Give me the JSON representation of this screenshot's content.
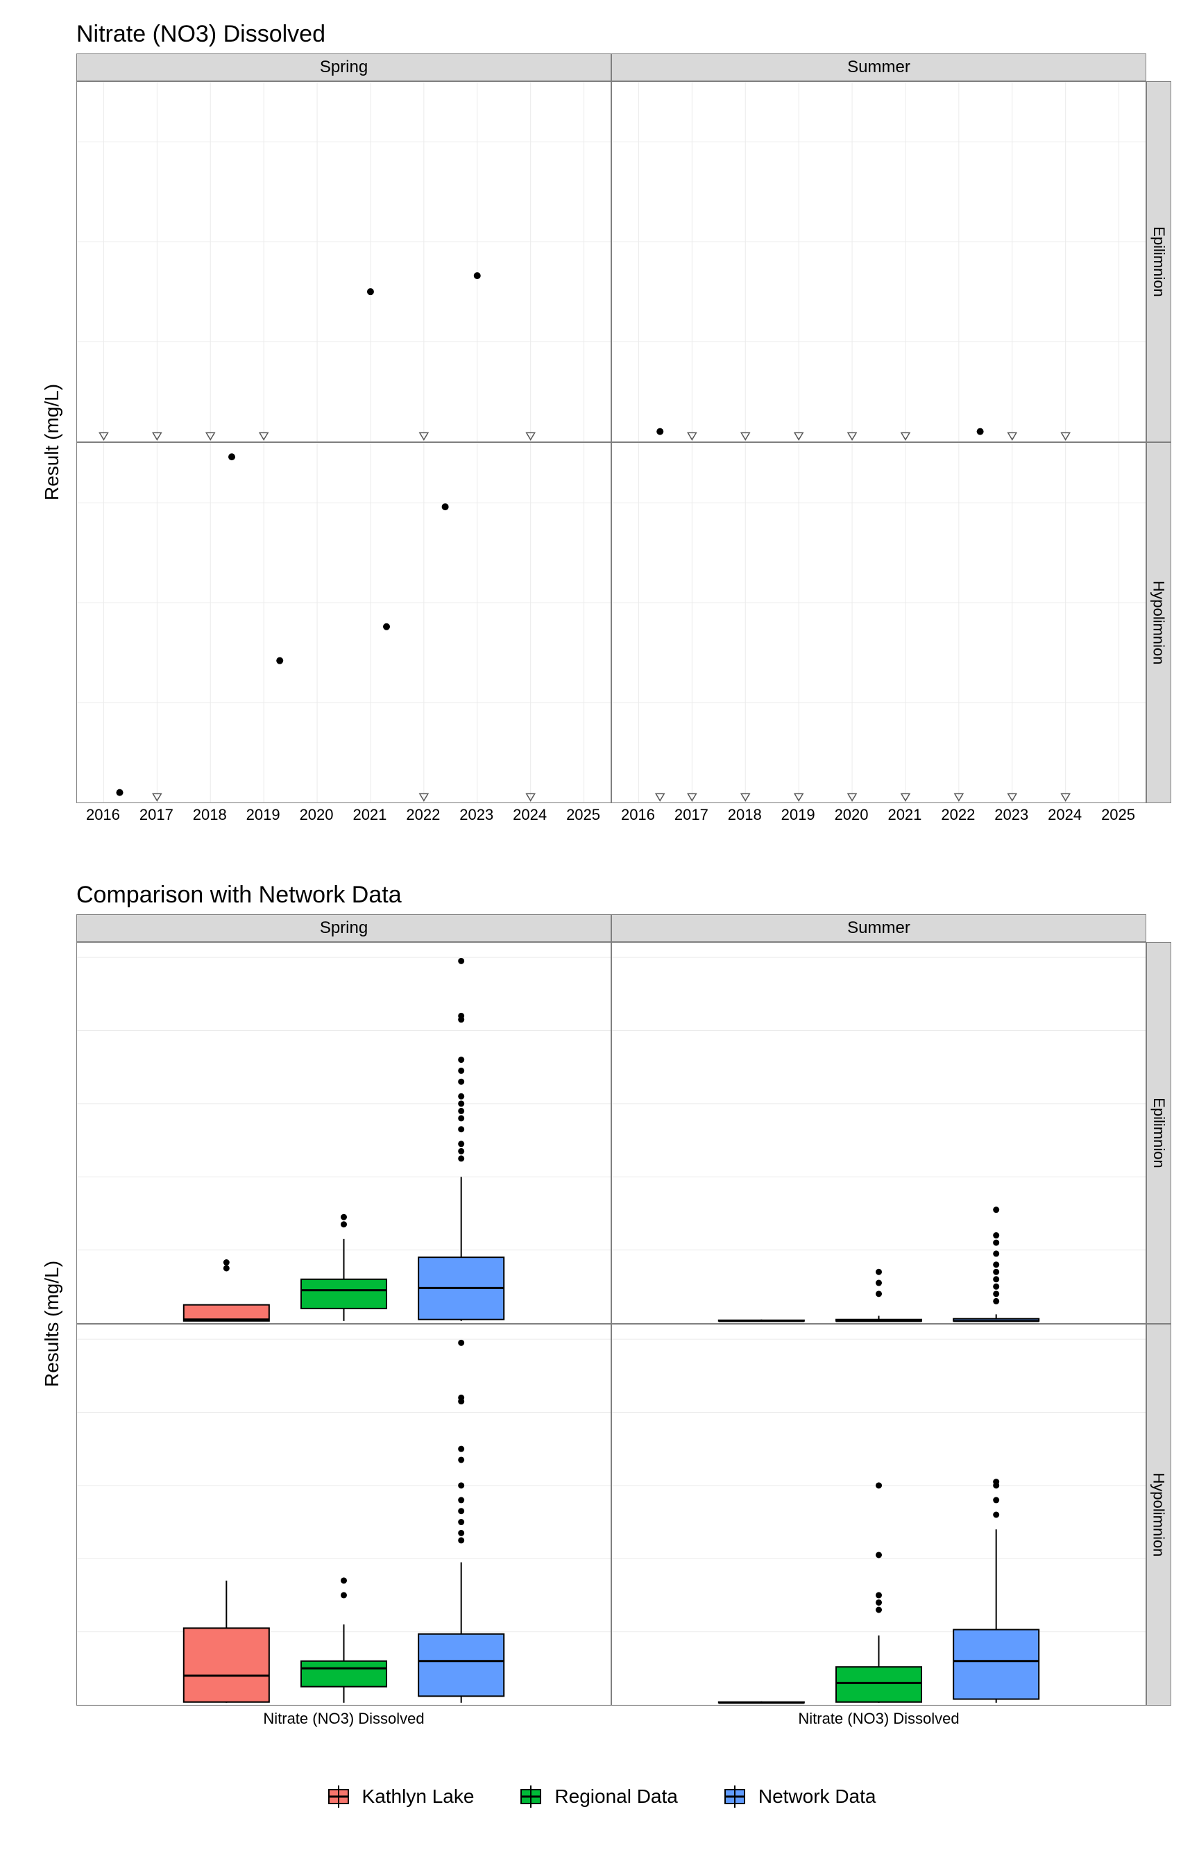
{
  "chart_data": [
    {
      "type": "scatter",
      "title": "Nitrate (NO3) Dissolved",
      "ylabel": "Result (mg/L)",
      "facets_col": [
        "Spring",
        "Summer"
      ],
      "facets_row": [
        "Epilimnion",
        "Hypolimnion"
      ],
      "x_ticks": [
        2016,
        2017,
        2018,
        2019,
        2020,
        2021,
        2022,
        2023,
        2024,
        2025
      ],
      "ylim": [
        0,
        0.18
      ],
      "y_ticks": [
        0.0,
        0.05,
        0.1,
        0.15
      ],
      "panels": {
        "Spring_Epilimnion": {
          "detect": [
            {
              "x": 2021,
              "y": 0.075
            },
            {
              "x": 2023,
              "y": 0.083
            }
          ],
          "nondetect": [
            {
              "x": 2016,
              "y": 0.003
            },
            {
              "x": 2017,
              "y": 0.003
            },
            {
              "x": 2018,
              "y": 0.003
            },
            {
              "x": 2019,
              "y": 0.003
            },
            {
              "x": 2022,
              "y": 0.003
            },
            {
              "x": 2024,
              "y": 0.003
            }
          ]
        },
        "Summer_Epilimnion": {
          "detect": [
            {
              "x": 2016.4,
              "y": 0.005
            },
            {
              "x": 2022.4,
              "y": 0.005
            }
          ],
          "nondetect": [
            {
              "x": 2017,
              "y": 0.003
            },
            {
              "x": 2018,
              "y": 0.003
            },
            {
              "x": 2019,
              "y": 0.003
            },
            {
              "x": 2020,
              "y": 0.003
            },
            {
              "x": 2021,
              "y": 0.003
            },
            {
              "x": 2023,
              "y": 0.003
            },
            {
              "x": 2024,
              "y": 0.003
            }
          ]
        },
        "Spring_Hypolimnion": {
          "detect": [
            {
              "x": 2016.3,
              "y": 0.005
            },
            {
              "x": 2018.4,
              "y": 0.173
            },
            {
              "x": 2019.3,
              "y": 0.071
            },
            {
              "x": 2021.3,
              "y": 0.088
            },
            {
              "x": 2022.4,
              "y": 0.148
            }
          ],
          "nondetect": [
            {
              "x": 2017,
              "y": 0.003
            },
            {
              "x": 2022,
              "y": 0.003
            },
            {
              "x": 2024,
              "y": 0.003
            }
          ]
        },
        "Summer_Hypolimnion": {
          "detect": [],
          "nondetect": [
            {
              "x": 2016.4,
              "y": 0.003
            },
            {
              "x": 2017,
              "y": 0.003
            },
            {
              "x": 2018,
              "y": 0.003
            },
            {
              "x": 2019,
              "y": 0.003
            },
            {
              "x": 2020,
              "y": 0.003
            },
            {
              "x": 2021,
              "y": 0.003
            },
            {
              "x": 2022,
              "y": 0.003
            },
            {
              "x": 2023,
              "y": 0.003
            },
            {
              "x": 2024,
              "y": 0.003
            }
          ]
        }
      }
    },
    {
      "type": "boxplot",
      "title": "Comparison with Network Data",
      "ylabel": "Results (mg/L)",
      "facets_col": [
        "Spring",
        "Summer"
      ],
      "facets_row": [
        "Epilimnion",
        "Hypolimnion"
      ],
      "x_category_label": "Nitrate (NO3) Dissolved",
      "series_names": [
        "Kathlyn Lake",
        "Regional Data",
        "Network Data"
      ],
      "series_colors": {
        "Kathlyn Lake": "#F8766D",
        "Regional Data": "#00BA38",
        "Network Data": "#619CFF"
      },
      "ylim": [
        0,
        0.52
      ],
      "y_ticks": [
        0.0,
        0.1,
        0.2,
        0.3,
        0.4,
        0.5
      ],
      "panels": {
        "Spring_Epilimnion": {
          "Kathlyn Lake": {
            "min": 0.003,
            "q1": 0.003,
            "med": 0.005,
            "q3": 0.025,
            "max": 0.025,
            "outliers": [
              0.075,
              0.083
            ]
          },
          "Regional Data": {
            "min": 0.003,
            "q1": 0.02,
            "med": 0.045,
            "q3": 0.06,
            "max": 0.115,
            "outliers": [
              0.135,
              0.145
            ]
          },
          "Network Data": {
            "min": 0.003,
            "q1": 0.005,
            "med": 0.048,
            "q3": 0.09,
            "max": 0.2,
            "outliers": [
              0.225,
              0.235,
              0.245,
              0.265,
              0.28,
              0.29,
              0.3,
              0.31,
              0.33,
              0.345,
              0.36,
              0.415,
              0.42,
              0.495
            ]
          }
        },
        "Summer_Epilimnion": {
          "Kathlyn Lake": {
            "min": 0.003,
            "q1": 0.003,
            "med": 0.003,
            "q3": 0.004,
            "max": 0.005,
            "outliers": []
          },
          "Regional Data": {
            "min": 0.003,
            "q1": 0.003,
            "med": 0.003,
            "q3": 0.005,
            "max": 0.01,
            "outliers": [
              0.04,
              0.055,
              0.07
            ]
          },
          "Network Data": {
            "min": 0.003,
            "q1": 0.003,
            "med": 0.003,
            "q3": 0.006,
            "max": 0.012,
            "outliers": [
              0.03,
              0.04,
              0.05,
              0.06,
              0.07,
              0.08,
              0.095,
              0.11,
              0.12,
              0.155
            ]
          }
        },
        "Spring_Hypolimnion": {
          "Kathlyn Lake": {
            "min": 0.003,
            "q1": 0.004,
            "med": 0.04,
            "q3": 0.105,
            "max": 0.17,
            "outliers": []
          },
          "Regional Data": {
            "min": 0.003,
            "q1": 0.025,
            "med": 0.05,
            "q3": 0.06,
            "max": 0.11,
            "outliers": [
              0.15,
              0.17
            ]
          },
          "Network Data": {
            "min": 0.003,
            "q1": 0.012,
            "med": 0.06,
            "q3": 0.097,
            "max": 0.195,
            "outliers": [
              0.225,
              0.235,
              0.25,
              0.265,
              0.28,
              0.3,
              0.335,
              0.35,
              0.415,
              0.42,
              0.495
            ]
          }
        },
        "Summer_Hypolimnion": {
          "Kathlyn Lake": {
            "min": 0.003,
            "q1": 0.003,
            "med": 0.003,
            "q3": 0.004,
            "max": 0.005,
            "outliers": []
          },
          "Regional Data": {
            "min": 0.003,
            "q1": 0.004,
            "med": 0.03,
            "q3": 0.052,
            "max": 0.095,
            "outliers": [
              0.13,
              0.14,
              0.15,
              0.205,
              0.3
            ]
          },
          "Network Data": {
            "min": 0.003,
            "q1": 0.008,
            "med": 0.06,
            "q3": 0.103,
            "max": 0.24,
            "outliers": [
              0.26,
              0.28,
              0.3,
              0.305
            ]
          }
        }
      }
    }
  ],
  "legend": {
    "items": [
      {
        "label": "Kathlyn Lake",
        "color": "#F8766D"
      },
      {
        "label": "Regional Data",
        "color": "#00BA38"
      },
      {
        "label": "Network Data",
        "color": "#619CFF"
      }
    ]
  }
}
